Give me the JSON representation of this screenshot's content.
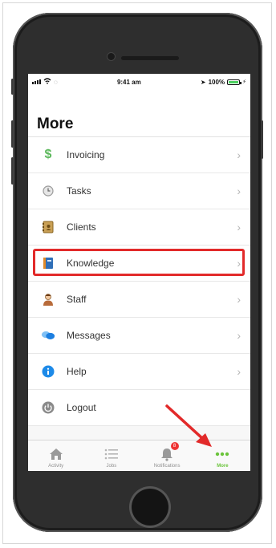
{
  "status": {
    "time": "9:41 am",
    "battery": "100%"
  },
  "header": {
    "title": "More"
  },
  "menu": {
    "items": [
      {
        "label": "Invoicing",
        "icon": "dollar-icon",
        "color": "#5cb85c"
      },
      {
        "label": "Tasks",
        "icon": "clock-icon",
        "color": "#9a9a9a"
      },
      {
        "label": "Clients",
        "icon": "address-book-icon",
        "color": "#b8893a"
      },
      {
        "label": "Knowledge",
        "icon": "book-icon",
        "color": "#2f6fb8"
      },
      {
        "label": "Staff",
        "icon": "person-icon",
        "color": "#b86b3a"
      },
      {
        "label": "Messages",
        "icon": "chat-bubbles-icon",
        "color": "#2f8ee0"
      },
      {
        "label": "Help",
        "icon": "info-icon",
        "color": "#1d8ae8"
      },
      {
        "label": "Logout",
        "icon": "power-icon",
        "color": "#8a8a8a"
      }
    ]
  },
  "tabs": [
    {
      "label": "Activity",
      "icon": "home-icon"
    },
    {
      "label": "Jobs",
      "icon": "list-icon"
    },
    {
      "label": "Notifications",
      "icon": "bell-icon",
      "badge": "8"
    },
    {
      "label": "More",
      "icon": "more-dots-icon",
      "active": true
    }
  ],
  "colors": {
    "accent": "#6bc43c",
    "highlight": "#e22a2a"
  }
}
